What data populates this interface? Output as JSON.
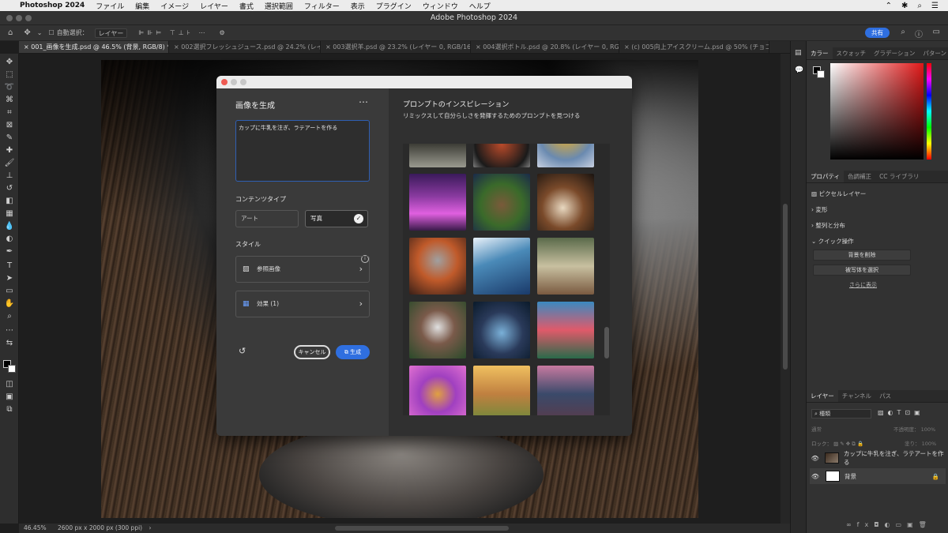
{
  "menubar": {
    "app": "Photoshop 2024",
    "items": [
      "ファイル",
      "編集",
      "イメージ",
      "レイヤー",
      "書式",
      "選択範囲",
      "フィルター",
      "表示",
      "プラグイン",
      "ウィンドウ",
      "ヘルプ"
    ]
  },
  "window_title": "Adobe Photoshop 2024",
  "options_bar": {
    "auto_select": "自動選択：",
    "target": "レイヤー",
    "share": "共有"
  },
  "tabs": [
    "001_画像を生成.psd @ 46.5% (背景, RGB/8) *",
    "002選択フレッシュジュース.psd @ 24.2% (レイ...",
    "003選択羊.psd @ 23.2% (レイヤー 0, RGB/16...",
    "004選択ボトル.psd @ 20.8% (レイヤー 0, RGB/...",
    "(c) 005向上アイスクリーム.psd @ 50% (チョコ..."
  ],
  "status": {
    "zoom": "46.45%",
    "doc": "2600 px x 2000 px (300 ppi)"
  },
  "color_panel": {
    "tabs": [
      "カラー",
      "スウォッチ",
      "グラデーション",
      "パターン"
    ]
  },
  "properties_panel": {
    "tabs": [
      "プロパティ",
      "色調補正",
      "CC ライブラリ"
    ],
    "layer_type": "ピクセルレイヤー",
    "sections": [
      "変形",
      "整列と分布",
      "クイック操作"
    ],
    "buttons": [
      "背景を削除",
      "被写体を選択"
    ],
    "more": "さらに表示"
  },
  "layers_panel": {
    "tabs": [
      "レイヤー",
      "チャンネル",
      "パス"
    ],
    "filter": "種類",
    "blend": "通常",
    "opacity_label": "不透明度：",
    "opacity": "100%",
    "lock_label": "ロック：",
    "fill_label": "塗り：",
    "fill": "100%",
    "layers": [
      {
        "name": "カップに牛乳を注ぎ、ラテアートを作る"
      },
      {
        "name": "背景"
      }
    ]
  },
  "dialog": {
    "title": "画像を生成",
    "prompt": "カップに牛乳を注ぎ、ラテアートを作る",
    "content_type_label": "コンテンツタイプ",
    "content_types": [
      "アート",
      "写真"
    ],
    "style_label": "スタイル",
    "reference_image": "参照画像",
    "effects": "効果 (1)",
    "cancel": "キャンセル",
    "generate": "生成",
    "inspiration_title": "プロンプトのインスピレーション",
    "inspiration_sub": "リミックスして自分らしさを発揮するためのプロンプトを見つける"
  },
  "colors": {
    "accent": "#2f6fe0",
    "panel": "#323232",
    "dialog_left": "#3a3a3a",
    "dialog_right": "#303030"
  }
}
